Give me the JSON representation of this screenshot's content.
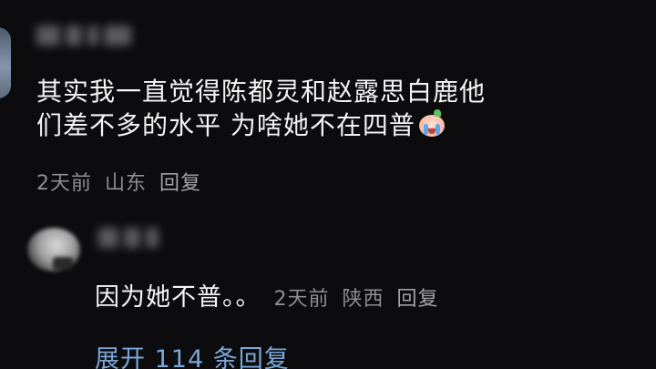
{
  "comment": {
    "text_line1": "其实我一直觉得陈都灵和赵露思白鹿他",
    "text_line2": "们差不多的水平 为啥她不在四普",
    "emoji": "crying-face-emoji",
    "time": "2天前",
    "location": "山东",
    "reply_label": "回复"
  },
  "reply": {
    "text": "因为她不普。。",
    "time": "2天前",
    "location": "陕西",
    "reply_label": "回复"
  },
  "expand": {
    "label": "展开 114 条回复"
  },
  "colors": {
    "background": "#0c0c0e",
    "text": "#f4f4f4",
    "meta": "#8e8e93",
    "link": "#7aa7d9"
  }
}
